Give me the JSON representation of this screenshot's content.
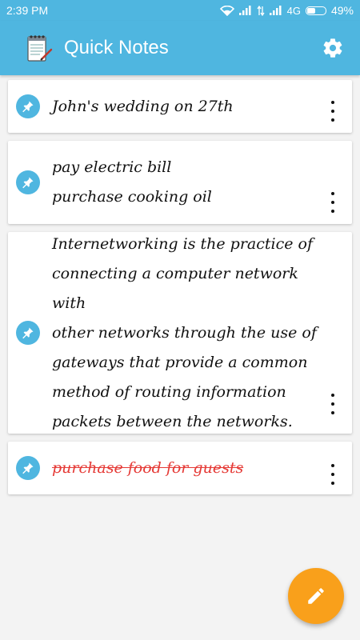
{
  "status_bar": {
    "time": "2:39 PM",
    "network": "4G",
    "battery": "49%"
  },
  "app_bar": {
    "title": "Quick Notes",
    "logo_icon": "notepad-icon",
    "action_icon": "gear-icon"
  },
  "notes": [
    {
      "text": "John's wedding on 27th",
      "completed": false,
      "pin_icon": "pin-icon",
      "menu_icon": "more-vert-icon"
    },
    {
      "text": "pay electric bill\npurchase cooking oil",
      "completed": false,
      "pin_icon": "pin-icon",
      "menu_icon": "more-vert-icon"
    },
    {
      "text": "Internetworking is the practice of\nconnecting a computer network with\nother networks through the use of\ngateways that provide a common\nmethod of routing information\npackets between the networks.",
      "completed": false,
      "pin_icon": "pin-icon",
      "menu_icon": "more-vert-icon"
    },
    {
      "text": "purchase food for guests",
      "completed": true,
      "pin_icon": "pin-icon",
      "menu_icon": "more-vert-icon"
    }
  ],
  "fab": {
    "icon": "pencil-icon"
  },
  "colors": {
    "primary": "#4fb6e0",
    "accent": "#f9a01b",
    "completed_text": "#e53935",
    "background": "#f3f3f3"
  }
}
